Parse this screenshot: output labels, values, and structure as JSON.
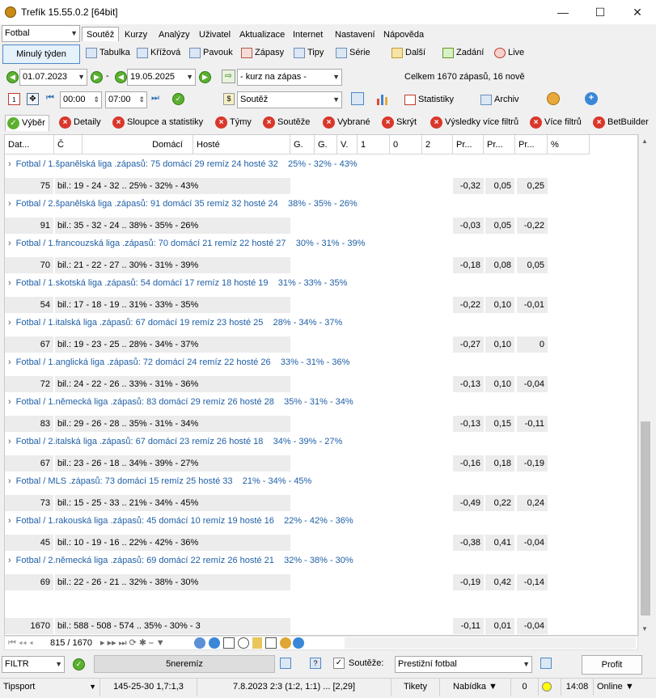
{
  "window": {
    "title": "Trefík 15.55.0.2 [64bit]"
  },
  "sport_select": "Fotbal",
  "menu": [
    "Soutěž",
    "Kurzy",
    "Analýzy",
    "Uživatel",
    "Aktualizace",
    "Internet",
    "Nastavení",
    "Nápověda"
  ],
  "toolbar": {
    "last_week": "Minulý týden",
    "items": [
      "Tabulka",
      "Křížová",
      "Pavouk",
      "Zápasy",
      "Tipy",
      "Série",
      "Další",
      "Zadání",
      "Live"
    ]
  },
  "date_from": "01.07.2023",
  "date_to": "19.05.2025",
  "dash": "-",
  "odds_select": "- kurz na zápas -",
  "summary": "Celkem 1670 zápasů, 16 nově",
  "time_from": "00:00",
  "time_to": "07:00",
  "competition_select": "Soutěž",
  "stats_label": "Statistiky",
  "archive_label": "Archiv",
  "filter_tabs": [
    "Výběr",
    "Detaily",
    "Sloupce a statistiky",
    "Týmy",
    "Soutěže",
    "Vybrané",
    "Skrýt",
    "Výsledky více filtrů",
    "Více filtrů",
    "BetBuilder"
  ],
  "columns": [
    "Dat...",
    "Č",
    "Domácí",
    "Hosté",
    "G.",
    "G.",
    "V.",
    "1",
    "0",
    "2",
    "Pr...",
    "Pr...",
    "Pr...",
    "%"
  ],
  "groups": [
    {
      "title": "Fotbal / 1.španělská liga .zápasů: 75  domácí 29  remíz 24  hosté 32",
      "pct": "25% - 32% - 43%",
      "count": "75",
      "bil": "bil.: 19 - 24 - 32 .. 25% - 32% - 43%",
      "p1": "-0,32",
      "p2": "0,05",
      "p3": "0,25"
    },
    {
      "title": "Fotbal / 2.španělská liga .zápasů: 91  domácí 35  remíz 32  hosté 24",
      "pct": "38% - 35% - 26%",
      "count": "91",
      "bil": "bil.: 35 - 32 - 24 .. 38% - 35% - 26%",
      "p1": "-0,03",
      "p2": "0,05",
      "p3": "-0,22"
    },
    {
      "title": "Fotbal / 1.francouzská liga .zápasů: 70  domácí 21  remíz 22  hosté 27",
      "pct": "30% - 31% - 39%",
      "count": "70",
      "bil": "bil.: 21 - 22 - 27 .. 30% - 31% - 39%",
      "p1": "-0,18",
      "p2": "0,08",
      "p3": "0,05"
    },
    {
      "title": "Fotbal / 1.skotská liga .zápasů: 54  domácí 17  remíz 18  hosté 19",
      "pct": "31% - 33% - 35%",
      "count": "54",
      "bil": "bil.: 17 - 18 - 19 .. 31% - 33% - 35%",
      "p1": "-0,22",
      "p2": "0,10",
      "p3": "-0,01"
    },
    {
      "title": "Fotbal / 1.italská liga .zápasů: 67  domácí 19  remíz 23  hosté 25",
      "pct": "28% - 34% - 37%",
      "count": "67",
      "bil": "bil.: 19 - 23 - 25 .. 28% - 34% - 37%",
      "p1": "-0,27",
      "p2": "0,10",
      "p3": "0"
    },
    {
      "title": "Fotbal / 1.anglická liga .zápasů: 72  domácí 24  remíz 22  hosté 26",
      "pct": "33% - 31% - 36%",
      "count": "72",
      "bil": "bil.: 24 - 22 - 26 .. 33% - 31% - 36%",
      "p1": "-0,13",
      "p2": "0,10",
      "p3": "-0,04"
    },
    {
      "title": "Fotbal / 1.německá liga .zápasů: 83  domácí 29  remíz 26  hosté 28",
      "pct": "35% - 31% - 34%",
      "count": "83",
      "bil": "bil.: 29 - 26 - 28 .. 35% - 31% - 34%",
      "p1": "-0,13",
      "p2": "0,15",
      "p3": "-0,11"
    },
    {
      "title": "Fotbal / 2.italská liga .zápasů: 67  domácí 23  remíz 26  hosté 18",
      "pct": "34% - 39% - 27%",
      "count": "67",
      "bil": "bil.: 23 - 26 - 18 .. 34% - 39% - 27%",
      "p1": "-0,16",
      "p2": "0,18",
      "p3": "-0,19"
    },
    {
      "title": "Fotbal / MLS .zápasů: 73  domácí 15  remíz 25  hosté 33",
      "pct": "21% - 34% - 45%",
      "count": "73",
      "bil": "bil.: 15 - 25 - 33 .. 21% - 34% - 45%",
      "p1": "-0,49",
      "p2": "0,22",
      "p3": "0,24"
    },
    {
      "title": "Fotbal / 1.rakouská liga .zápasů: 45  domácí 10  remíz 19  hosté 16",
      "pct": "22% - 42% - 36%",
      "count": "45",
      "bil": "bil.: 10 - 19 - 16 .. 22% - 42% - 36%",
      "p1": "-0,38",
      "p2": "0,41",
      "p3": "-0,04"
    },
    {
      "title": "Fotbal / 2.německá liga .zápasů: 69  domácí 22  remíz 26  hosté 21",
      "pct": "32% - 38% - 30%",
      "count": "69",
      "bil": "bil.: 22 - 26 - 21 .. 32% - 38% - 30%",
      "p1": "-0,19",
      "p2": "0,42",
      "p3": "-0,14"
    }
  ],
  "total": {
    "count": "1670",
    "bil": "bil.: 588 - 508 - 574 .. 35% - 30% - 3",
    "p1": "-0,11",
    "p2": "0,01",
    "p3": "-0,04"
  },
  "nav": {
    "position": "815 / 1670"
  },
  "bottom": {
    "filter_label": "FILTR",
    "filter_name": "5neremíz",
    "souteze_label": "Soutěže:",
    "souteze_value": "Prestižní fotbal",
    "profit_label": "Profit"
  },
  "status": {
    "bookmaker": "Tipsport",
    "score": "145-25-30  1,7:1,3",
    "match": "7.8.2023 2:3 (1:2, 1:1) ... [2,29]",
    "tickets": "Tikety",
    "offer": "Nabídka ▼",
    "zero": "0",
    "time": "14:08",
    "online": "Online ▼"
  }
}
